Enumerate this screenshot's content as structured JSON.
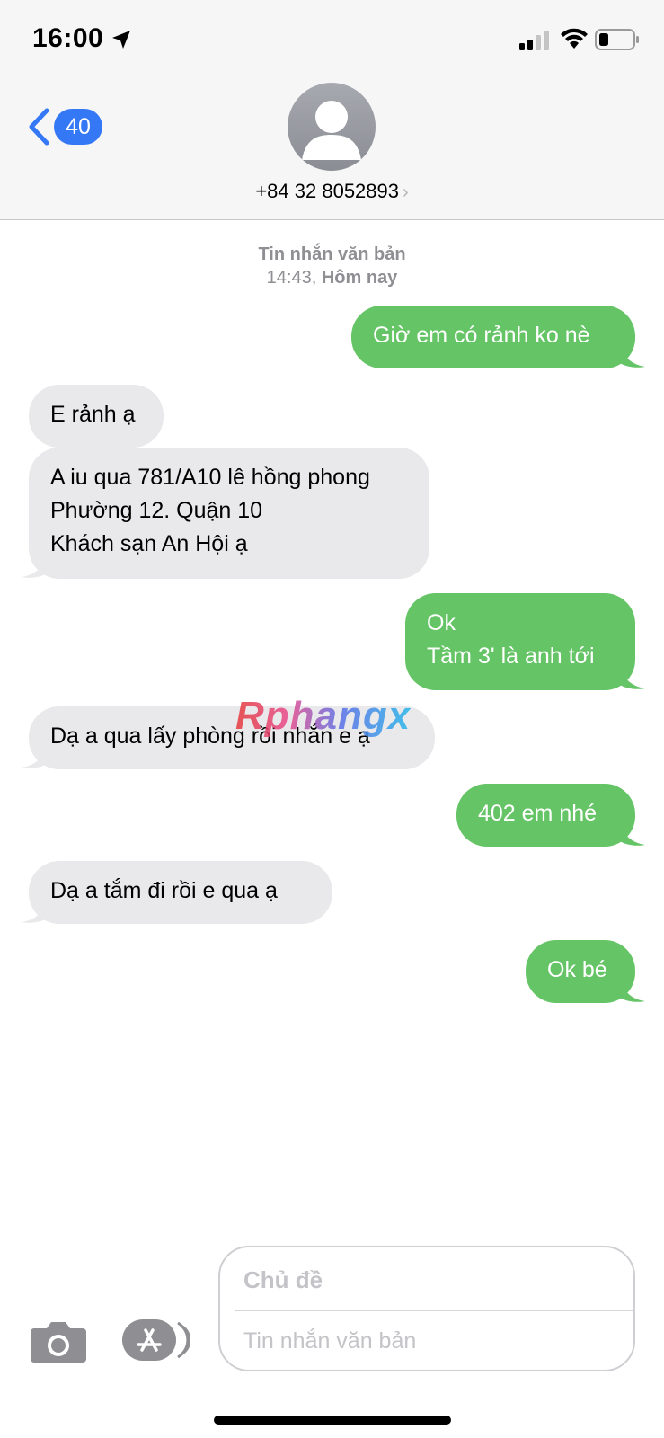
{
  "status_bar": {
    "time": "16:00"
  },
  "header": {
    "back_badge": "40",
    "contact": "+84 32 8052893",
    "contact_chevron": "›"
  },
  "thread": {
    "meta_kind": "Tin nhắn văn bản",
    "meta_date": "Hôm nay",
    "meta_time": "14:43,",
    "messages": [
      {
        "dir": "sent",
        "text": "Giờ em có rảnh ko nè"
      },
      {
        "dir": "received",
        "text": "E rảnh ạ"
      },
      {
        "dir": "received",
        "text": "A iu qua 781/A10 lê hồng phong\nPhường 12. Quận 10\nKhách sạn An Hội ạ"
      },
      {
        "dir": "sent",
        "text": "Ok\nTầm 3' là anh tới"
      },
      {
        "dir": "received",
        "text": "Dạ a qua lấy phòng rồi nhắn e ạ"
      },
      {
        "dir": "sent",
        "text": "402 em nhé"
      },
      {
        "dir": "received",
        "text": "Dạ a tắm đi rồi e qua ạ"
      },
      {
        "dir": "sent",
        "text": "Ok bé"
      }
    ]
  },
  "watermark": "Rphangx",
  "composer": {
    "subject_placeholder": "Chủ đề",
    "message_placeholder": "Tin nhắn văn bản"
  },
  "icons": [
    "location-arrow-icon",
    "signal-icon",
    "wifi-icon",
    "battery-icon",
    "back-chevron-icon",
    "person-icon",
    "camera-icon",
    "appstore-icon"
  ],
  "colors": {
    "sent": "#65c466",
    "received": "#e9e9eb",
    "accent": "#3478f6"
  }
}
